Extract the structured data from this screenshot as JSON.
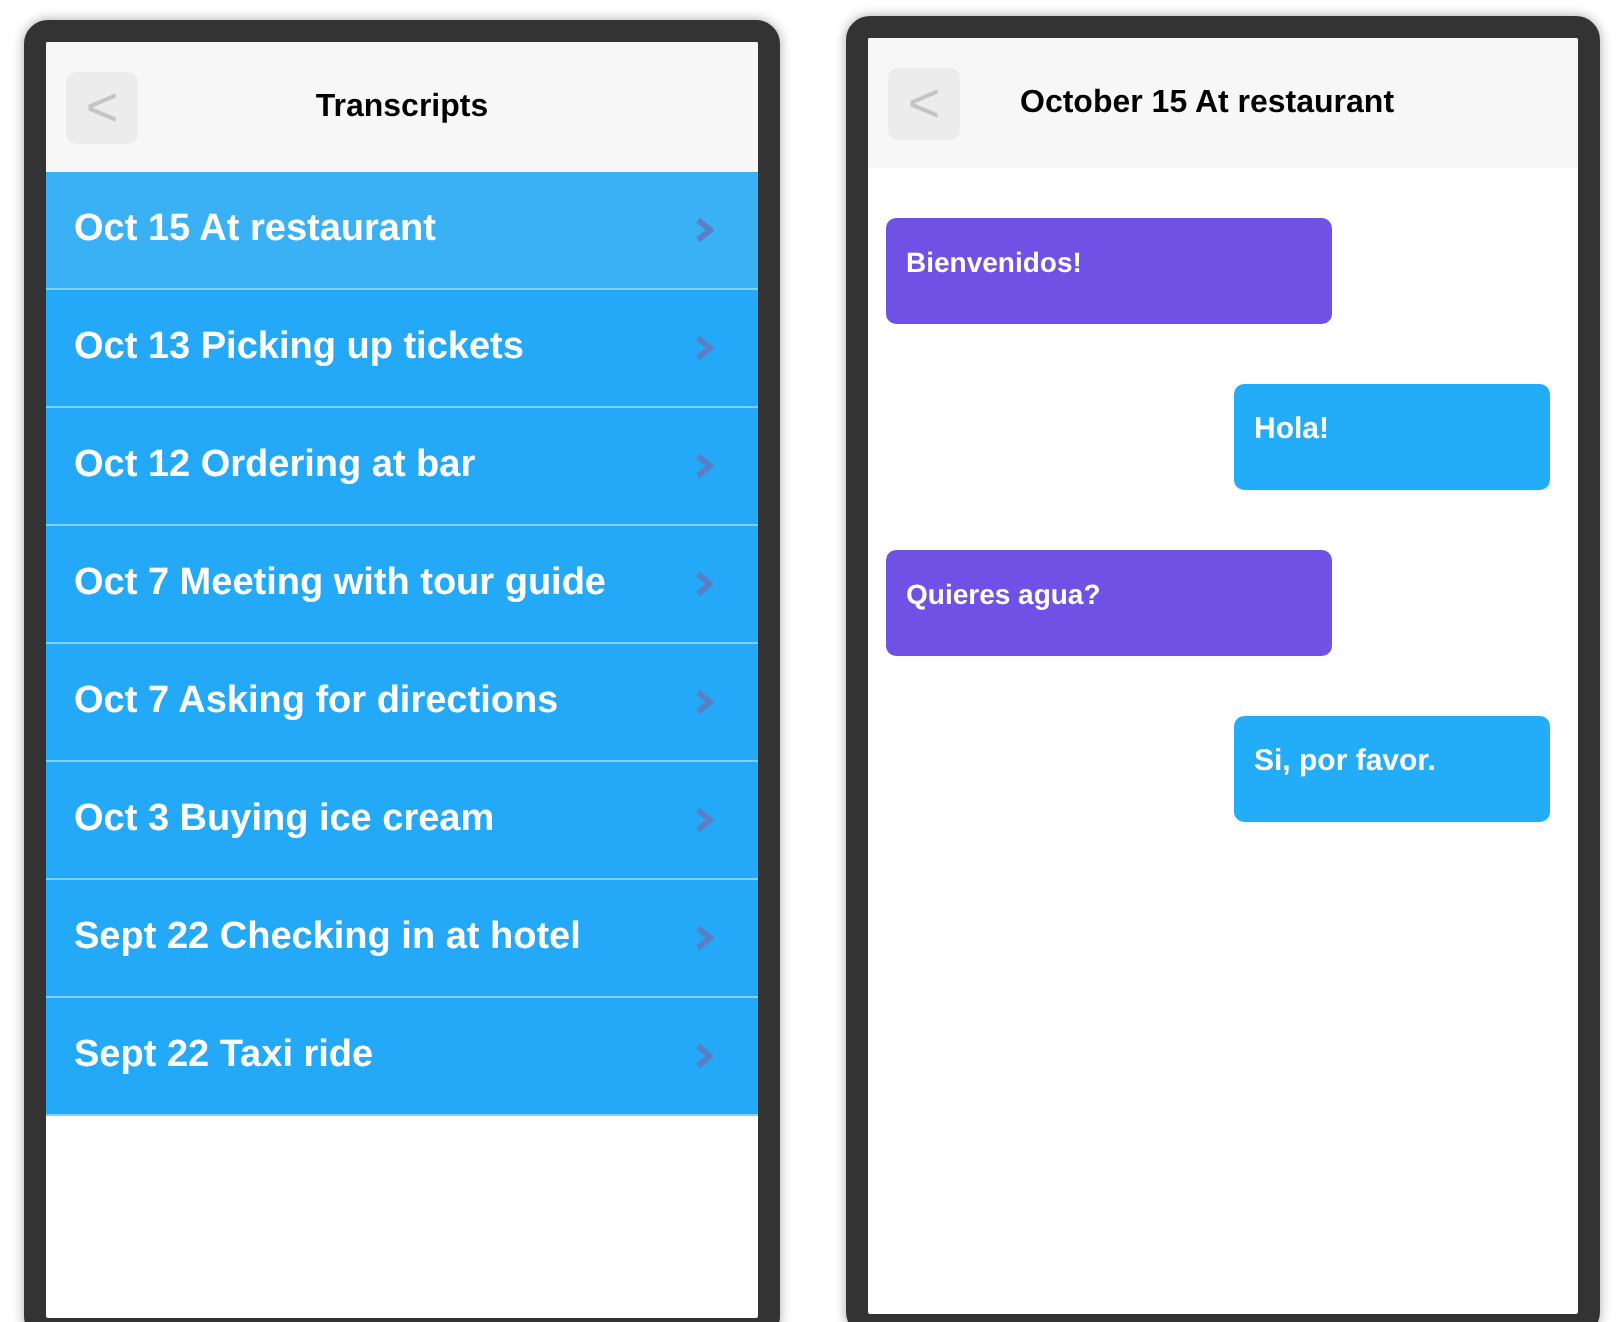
{
  "transcripts_screen": {
    "back_button": "<",
    "title": "Transcripts",
    "items": [
      {
        "label": "Oct 15 At restaurant",
        "selected": true
      },
      {
        "label": "Oct 13 Picking up tickets",
        "selected": false
      },
      {
        "label": "Oct 12 Ordering at bar",
        "selected": false
      },
      {
        "label": "Oct 7 Meeting with tour guide",
        "selected": false
      },
      {
        "label": "Oct 7 Asking for directions",
        "selected": false
      },
      {
        "label": "Oct 3 Buying ice cream",
        "selected": false
      },
      {
        "label": "Sept 22 Checking in at hotel",
        "selected": false
      },
      {
        "label": "Sept 22 Taxi ride",
        "selected": false
      }
    ]
  },
  "conversation_screen": {
    "back_button": "<",
    "title": "October 15 At restaurant",
    "messages": [
      {
        "kind": "incoming",
        "text": "Bienvenidos!"
      },
      {
        "kind": "outgoing",
        "text": "Hola!"
      },
      {
        "kind": "incoming",
        "text": "Quieres agua?"
      },
      {
        "kind": "outgoing",
        "text": "Si, por favor."
      }
    ]
  }
}
